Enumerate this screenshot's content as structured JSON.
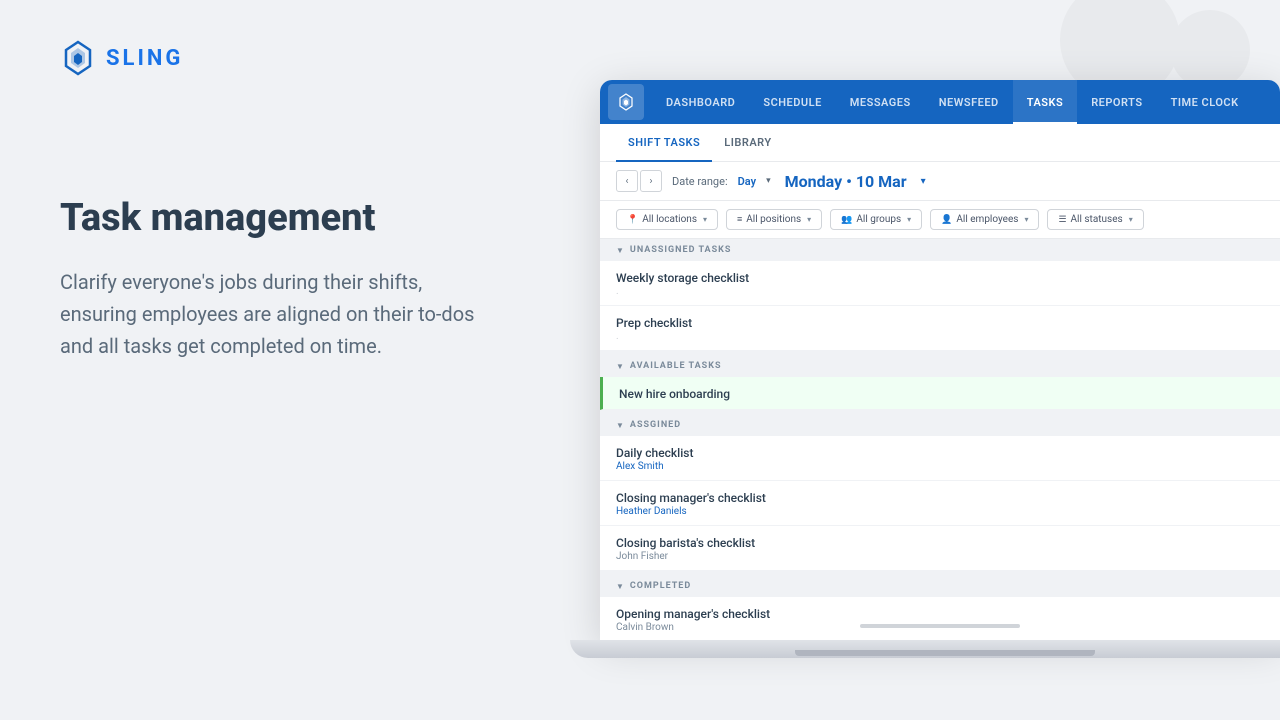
{
  "logo": {
    "text": "SLING"
  },
  "left": {
    "heading": "Task management",
    "description": "Clarify everyone's jobs during their shifts, ensuring employees are aligned on their to-dos and all tasks get completed on time."
  },
  "nav": {
    "items": [
      {
        "label": "DASHBOARD",
        "active": false
      },
      {
        "label": "SCHEDULE",
        "active": false
      },
      {
        "label": "MESSAGES",
        "active": false
      },
      {
        "label": "NEWSFEED",
        "active": false
      },
      {
        "label": "TASKS",
        "active": true
      },
      {
        "label": "REPORTS",
        "active": false
      },
      {
        "label": "TIME CLOCK",
        "active": false
      }
    ]
  },
  "sub_tabs": [
    {
      "label": "SHIFT TASKS",
      "active": true
    },
    {
      "label": "LIBRARY",
      "active": false
    }
  ],
  "date_nav": {
    "range_label": "Date range:",
    "range_value": "Day",
    "current_date": "Monday • 10 Mar"
  },
  "filters": [
    {
      "icon": "📍",
      "label": "All locations"
    },
    {
      "icon": "≡",
      "label": "All positions"
    },
    {
      "icon": "👥",
      "label": "All groups"
    },
    {
      "icon": "👤",
      "label": "All employees"
    },
    {
      "icon": "☰",
      "label": "All statuses"
    }
  ],
  "sections": [
    {
      "id": "unassigned",
      "label": "UNASSIGNED TASKS",
      "tasks": [
        {
          "name": "Weekly storage checklist",
          "sub": ".",
          "sub_type": "dot",
          "available": false
        },
        {
          "name": "Prep checklist",
          "sub": ".",
          "sub_type": "dot",
          "available": false
        }
      ]
    },
    {
      "id": "available",
      "label": "AVAILABLE TASKS",
      "tasks": [
        {
          "name": "New hire onboarding",
          "sub": "",
          "sub_type": "none",
          "available": true
        }
      ]
    },
    {
      "id": "assigned",
      "label": "ASSGINED",
      "tasks": [
        {
          "name": "Daily checklist",
          "sub": "Alex Smith",
          "sub_type": "blue",
          "available": false
        },
        {
          "name": "Closing manager's checklist",
          "sub": "Heather Daniels",
          "sub_type": "blue",
          "available": false
        },
        {
          "name": "Closing barista's checklist",
          "sub": "John Fisher",
          "sub_type": "normal",
          "available": false
        }
      ]
    },
    {
      "id": "completed",
      "label": "COMPLETED",
      "tasks": [
        {
          "name": "Opening manager's checklist",
          "sub": "Calvin Brown",
          "sub_type": "normal",
          "available": false
        }
      ]
    }
  ]
}
